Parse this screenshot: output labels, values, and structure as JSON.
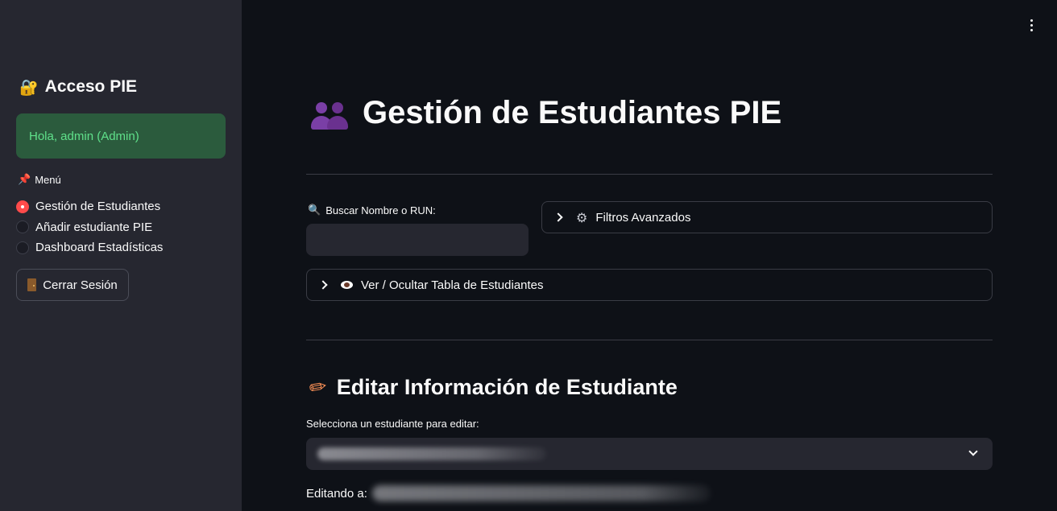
{
  "sidebar": {
    "title": "Acceso PIE",
    "greeting": "Hola, admin (Admin)",
    "menu_label": "Menú",
    "menu_items": [
      {
        "label": "Gestión de Estudiantes",
        "selected": true
      },
      {
        "label": "Añadir estudiante PIE",
        "selected": false
      },
      {
        "label": "Dashboard Estadísticas",
        "selected": false
      }
    ],
    "logout_label": "Cerrar Sesión",
    "icons": {
      "title": "lock-key-icon",
      "menu": "pushpin-icon",
      "logout": "door-icon"
    }
  },
  "main": {
    "title": "Gestión de Estudiantes PIE",
    "title_icon": "people-icon",
    "search": {
      "label": "Buscar Nombre o RUN:",
      "value": "",
      "placeholder": ""
    },
    "filters_expander": "Filtros Avanzados",
    "table_expander": "Ver / Ocultar Tabla de Estudiantes",
    "edit_section": {
      "title": "Editar Información de Estudiante",
      "select_label": "Selecciona un estudiante para editar:",
      "editing_label": "Editando a:"
    }
  },
  "colors": {
    "background": "#0e1117",
    "sidebar": "#262730",
    "accent": "#ff4b4b",
    "success_bg": "#2b5b3d",
    "success_text": "#5fe08a"
  }
}
